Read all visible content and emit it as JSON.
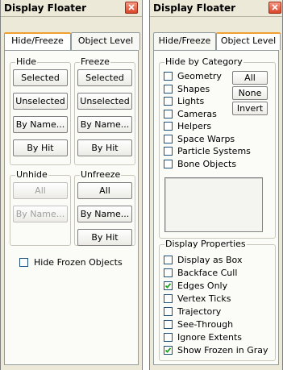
{
  "left": {
    "title": "Display Floater",
    "tabs": [
      "Hide/Freeze",
      "Object Level"
    ],
    "hide": {
      "label": "Hide",
      "buttons": [
        "Selected",
        "Unselected",
        "By Name...",
        "By Hit"
      ]
    },
    "freeze": {
      "label": "Freeze",
      "buttons": [
        "Selected",
        "Unselected",
        "By Name...",
        "By Hit"
      ]
    },
    "unhide": {
      "label": "Unhide",
      "buttons": [
        "All",
        "By Name..."
      ]
    },
    "unfreeze": {
      "label": "Unfreeze",
      "buttons": [
        "All",
        "By Name...",
        "By Hit"
      ]
    },
    "hide_frozen": {
      "label": "Hide Frozen Objects",
      "checked": false
    }
  },
  "right": {
    "title": "Display Floater",
    "tabs": [
      "Hide/Freeze",
      "Object Level"
    ],
    "hide_by_category": {
      "label": "Hide by Category",
      "items": [
        {
          "label": "Geometry",
          "checked": false
        },
        {
          "label": "Shapes",
          "checked": false
        },
        {
          "label": "Lights",
          "checked": false
        },
        {
          "label": "Cameras",
          "checked": false
        },
        {
          "label": "Helpers",
          "checked": false
        },
        {
          "label": "Space Warps",
          "checked": false
        },
        {
          "label": "Particle Systems",
          "checked": false
        },
        {
          "label": "Bone Objects",
          "checked": false
        }
      ],
      "buttons": [
        "All",
        "None",
        "Invert"
      ]
    },
    "display_properties": {
      "label": "Display Properties",
      "items": [
        {
          "label": "Display as Box",
          "checked": false
        },
        {
          "label": "Backface Cull",
          "checked": false
        },
        {
          "label": "Edges Only",
          "checked": true
        },
        {
          "label": "Vertex Ticks",
          "checked": false
        },
        {
          "label": "Trajectory",
          "checked": false
        },
        {
          "label": "See-Through",
          "checked": false
        },
        {
          "label": "Ignore Extents",
          "checked": false
        },
        {
          "label": "Show Frozen in Gray",
          "checked": true
        }
      ]
    }
  }
}
